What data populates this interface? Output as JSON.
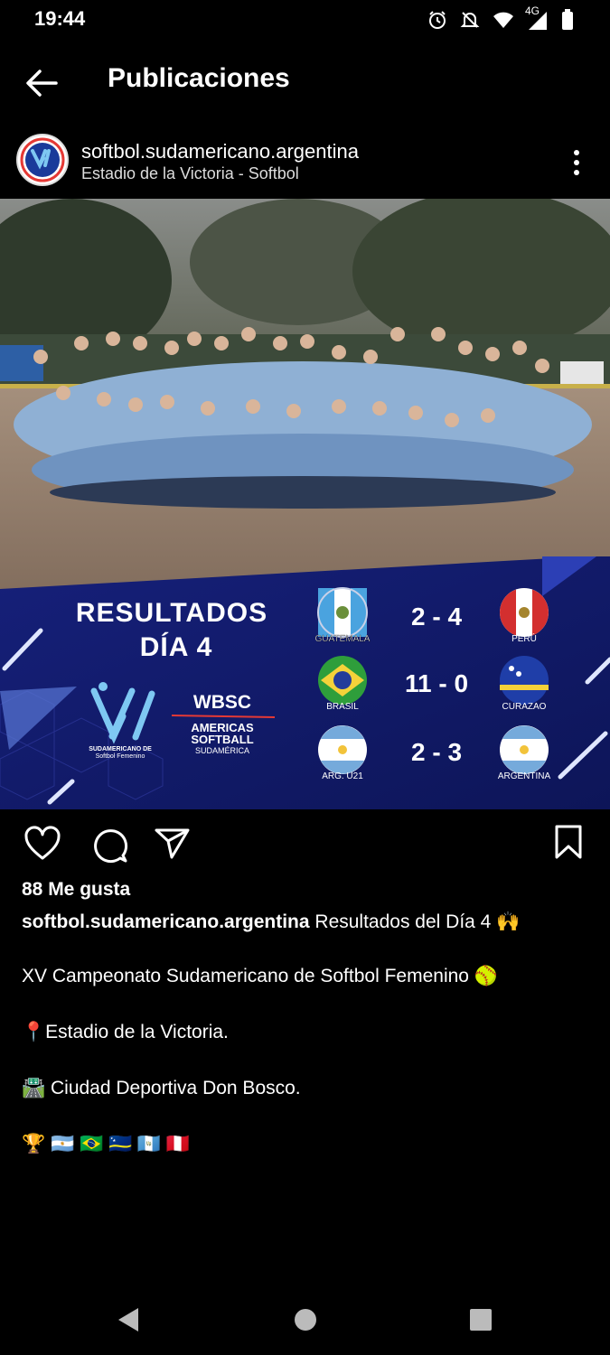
{
  "status_bar": {
    "time": "19:44",
    "network": "4G"
  },
  "header": {
    "title": "Publicaciones"
  },
  "post": {
    "username": "softbol.sudamericano.argentina",
    "location": "Estadio de la Victoria - Softbol",
    "graphic": {
      "heading_line1": "RESULTADOS",
      "heading_line2": "DÍA 4",
      "logo_caption_1": "SUDAMERICANO DE",
      "logo_caption_2": "Softbol Femenino",
      "wbsc": "WBSC",
      "americas_1": "AMERICAS",
      "americas_2": "SOFTBALL",
      "americas_3": "SUDAMÉRICA",
      "results": [
        {
          "home": "GUATEMALA",
          "score": "2 - 4",
          "away": "PERÚ"
        },
        {
          "home": "BRASIL",
          "score": "11 - 0",
          "away": "CURAZAO"
        },
        {
          "home": "ARG. U21",
          "score": "2 - 3",
          "away": "ARGENTINA"
        }
      ]
    },
    "likes": "88 Me gusta",
    "caption_user": "softbol.sudamericano.argentina",
    "caption_text": "Resultados del Día 4 🙌",
    "line1": "XV Campeonato Sudamericano de Softbol Femenino 🥎",
    "line2": "📍Estadio de la Victoria.",
    "line3": "🛣️ Ciudad Deportiva Don Bosco.",
    "line4": "🏆 🇦🇷 🇧🇷 🇨🇼 🇬🇹 🇵🇪"
  },
  "colors": {
    "banner": "#1a237e",
    "accent": "#ffffff"
  }
}
